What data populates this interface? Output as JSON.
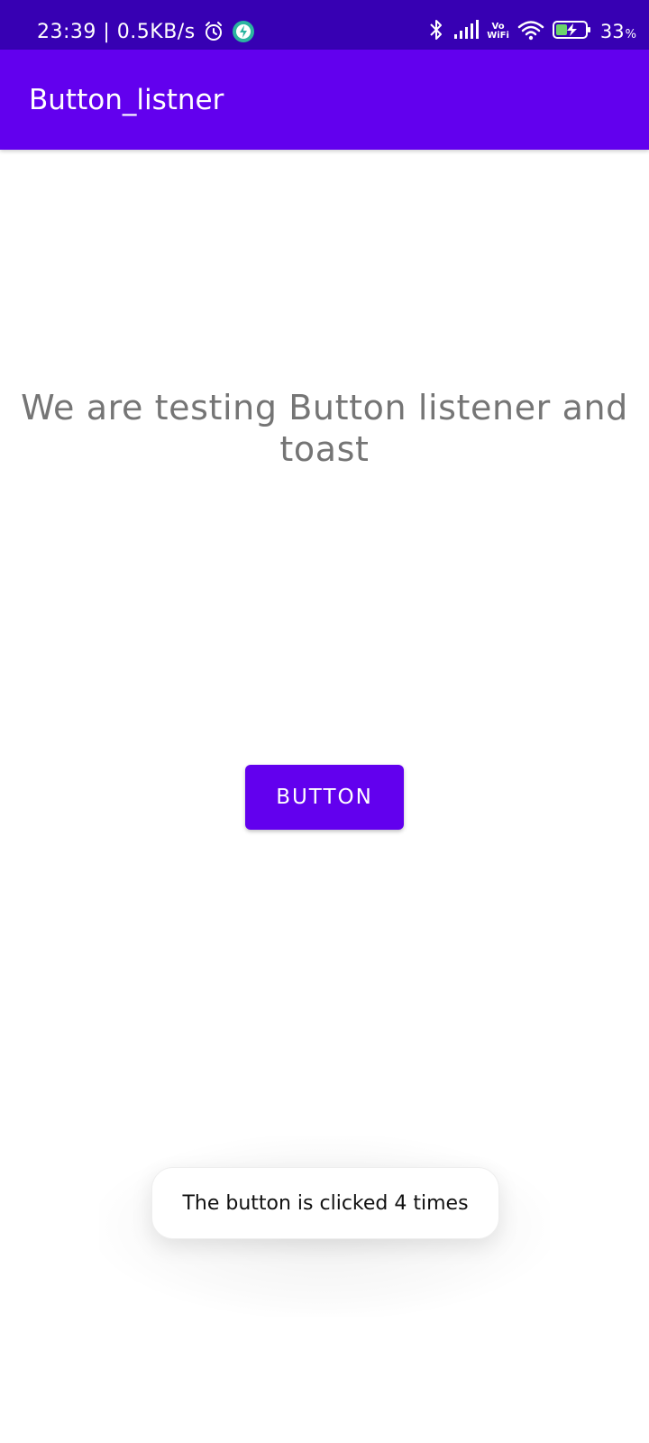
{
  "status_bar": {
    "time_speed": "23:39 | 0.5KB/s",
    "vowifi_top": "Vo",
    "vowifi_bottom": "WiFi",
    "battery_percent": "33",
    "battery_percent_sign": "%",
    "icons": [
      "alarm-icon",
      "shield-icon",
      "bluetooth-icon",
      "signal-icon",
      "vowifi-icon",
      "wifi-icon",
      "battery-charging-icon"
    ],
    "bg_color": "#3700B3"
  },
  "app_bar": {
    "title": "Button_listner",
    "bg_color": "#6200EE"
  },
  "main": {
    "headline": "We are testing Button listener and toast",
    "button_label": "BUTTON",
    "button_color": "#6200EE"
  },
  "toast": {
    "message": "The button is clicked 4 times"
  }
}
